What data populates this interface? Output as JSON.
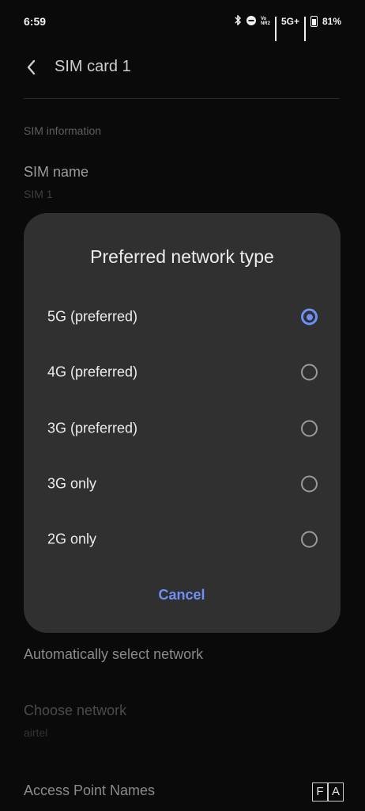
{
  "status_bar": {
    "time": "6:59",
    "network_label": "5G+",
    "volte_label": "Vo NR2",
    "battery": "81%"
  },
  "app_bar": {
    "title": "SIM card 1",
    "back_icon": "chevron-left-icon"
  },
  "settings": {
    "section_header": "SIM information",
    "sim_name_title": "SIM name",
    "sim_name_value": "SIM 1",
    "auto_select_title": "Automatically select network",
    "choose_network_title": "Choose network",
    "choose_network_value": "airtel",
    "apn_title": "Access Point Names"
  },
  "dialog": {
    "title": "Preferred network type",
    "options": [
      {
        "label": "5G (preferred)",
        "checked": true
      },
      {
        "label": "4G (preferred)",
        "checked": false
      },
      {
        "label": "3G (preferred)",
        "checked": false
      },
      {
        "label": "3G only",
        "checked": false
      },
      {
        "label": "2G only",
        "checked": false
      }
    ],
    "cancel_label": "Cancel",
    "accent_color": "#6f8ff5"
  },
  "badge": {
    "letter1": "F",
    "letter2": "A"
  }
}
